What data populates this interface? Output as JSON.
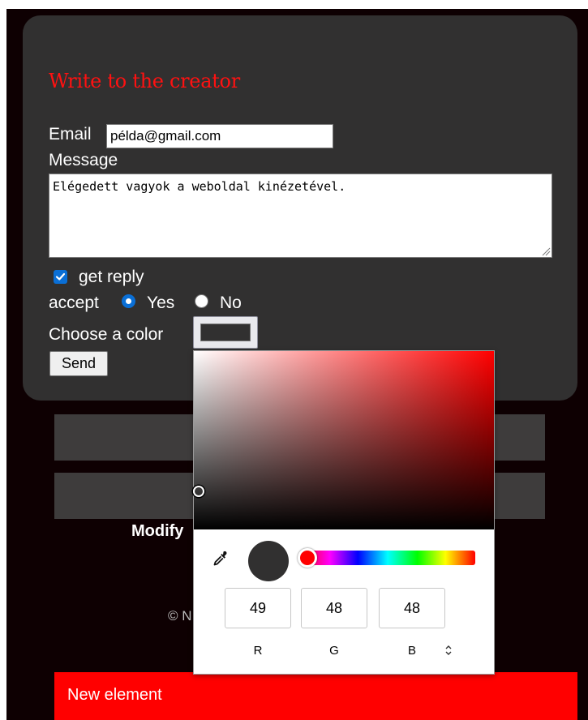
{
  "form": {
    "title": "Write to the creator",
    "email_label": "Email",
    "email_value": "példa@gmail.com",
    "message_label": "Message",
    "message_value": "Elégedett vagyok a weboldal kinézetével.",
    "reply_label": "get reply",
    "reply_checked": true,
    "accept_label": "accept",
    "radio_yes_label": "Yes",
    "radio_no_label": "No",
    "selected_radio": "Yes",
    "color_label": "Choose a color",
    "color_value": "#313030",
    "send_label": "Send"
  },
  "page": {
    "modify_text": "Modify",
    "copyright_text": "© N",
    "new_element_label": "New element"
  },
  "color_picker": {
    "r": "49",
    "g": "48",
    "b": "48",
    "r_label": "R",
    "g_label": "G",
    "b_label": "B",
    "hue_color": "#ff0000",
    "current_color": "#313030",
    "icons": [
      "eyedropper-icon",
      "format-toggle-icon"
    ]
  },
  "colors": {
    "page_background": "#0e0002",
    "card_background": "#313030",
    "title_color": "#ff1111",
    "accent_blue": "#0a6fd6",
    "bar_color": "#3e3c3c",
    "new_element_background": "#ff0000"
  }
}
